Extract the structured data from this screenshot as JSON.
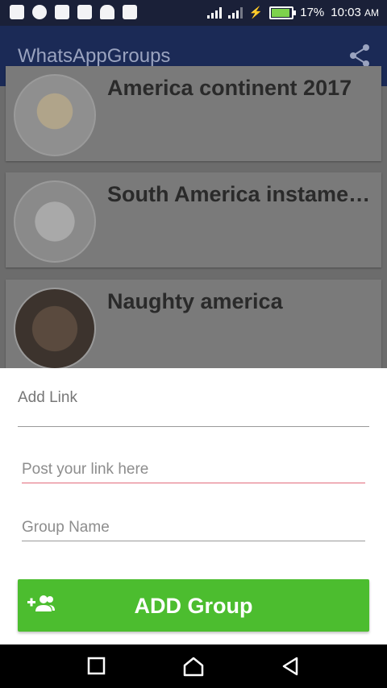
{
  "status_bar": {
    "battery": "17%",
    "time": "10:03",
    "ampm": "AM",
    "icons": [
      "gallery-icon",
      "whatsapp-icon",
      "gmail-icon",
      "mail-icon",
      "android-icon",
      "check-badge-icon",
      "signal-icon",
      "signal-icon",
      "charging-icon",
      "battery-icon"
    ]
  },
  "app_bar": {
    "title": "WhatsAppGroups",
    "share_icon": "share-icon"
  },
  "groups": [
    {
      "name": "America continent 2017"
    },
    {
      "name": "South America instamembers"
    },
    {
      "name": "Naughty america"
    }
  ],
  "dialog": {
    "title": "Add Link",
    "link_placeholder": "Post your link here",
    "link_value": "",
    "group_placeholder": "Group Name",
    "group_value": "",
    "button_label": "ADD Group",
    "button_icon": "group-add-icon"
  },
  "colors": {
    "app_bar": "#1b2a56",
    "button": "#4cbd2f",
    "link_underline": "#e26a7a"
  },
  "nav_bar": {
    "icons": [
      "recents-icon",
      "home-icon",
      "back-icon"
    ]
  }
}
